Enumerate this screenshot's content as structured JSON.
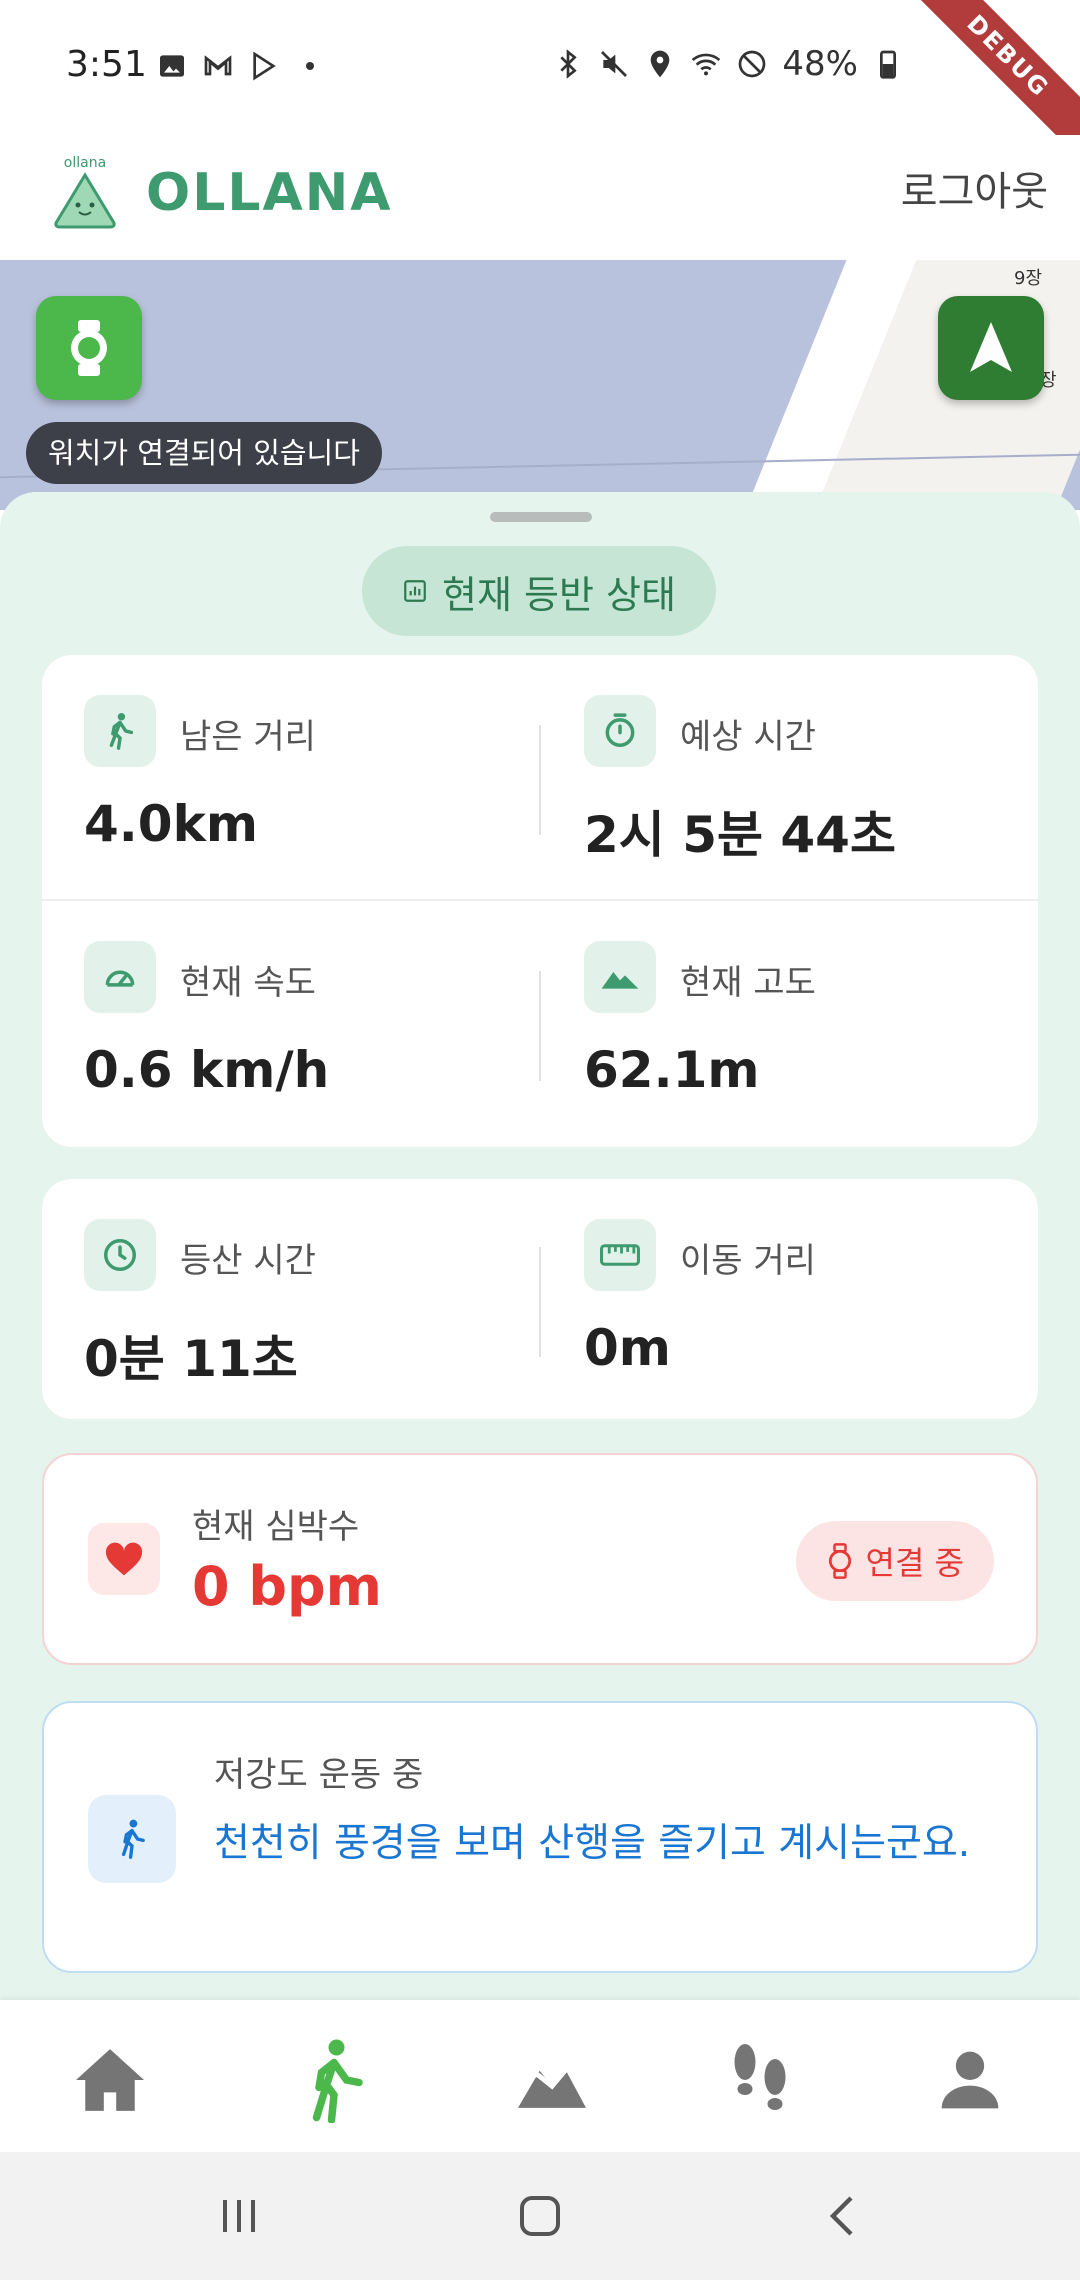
{
  "status_bar": {
    "time": "3:51",
    "battery": "48%",
    "icons_left": [
      "gallery-icon",
      "gmail-icon",
      "play-store-icon",
      "dot-icon"
    ],
    "icons_right": [
      "bluetooth-icon",
      "mute-icon",
      "location-icon",
      "wifi-icon",
      "do-not-disturb-icon",
      "battery-icon"
    ]
  },
  "debug_banner": "DEBUG",
  "header": {
    "logo_small": "ollana",
    "logo_text": "OLLANA",
    "logout_label": "로그아웃"
  },
  "map": {
    "labels": [
      "9장",
      "장"
    ],
    "watch_toast": "워치가 연결되어 있습니다"
  },
  "sheet": {
    "status_chip_label": "현재 등반 상태",
    "metrics_primary": [
      {
        "label": "남은 거리",
        "value": "4.0km",
        "icon": "hiker-icon"
      },
      {
        "label": "예상 시간",
        "value": "2시 5분 44초",
        "icon": "stopwatch-icon"
      },
      {
        "label": "현재 속도",
        "value": "0.6 km/h",
        "icon": "speedometer-icon"
      },
      {
        "label": "현재 고도",
        "value": "62.1m",
        "icon": "mountain-icon"
      }
    ],
    "metrics_secondary": [
      {
        "label": "등산 시간",
        "value": "0분 11초",
        "icon": "clock-icon"
      },
      {
        "label": "이동 거리",
        "value": "0m",
        "icon": "ruler-icon"
      }
    ],
    "heart_rate": {
      "label": "현재 심박수",
      "value": "0 bpm",
      "status": "연결 중"
    },
    "activity": {
      "title": "저강도 운동 중",
      "message": "천천히 풍경을 보며 산행을 즐기고 계시는군요."
    }
  },
  "bottom_nav": [
    "home-icon",
    "hiking-icon",
    "mountain-chart-icon",
    "footprints-icon",
    "profile-icon"
  ],
  "colors": {
    "brand_green": "#3e9a6f",
    "active_green": "#4cb84c",
    "heart_red": "#e53935",
    "info_blue": "#1976d2",
    "sheet_bg": "#e6f4ee"
  }
}
